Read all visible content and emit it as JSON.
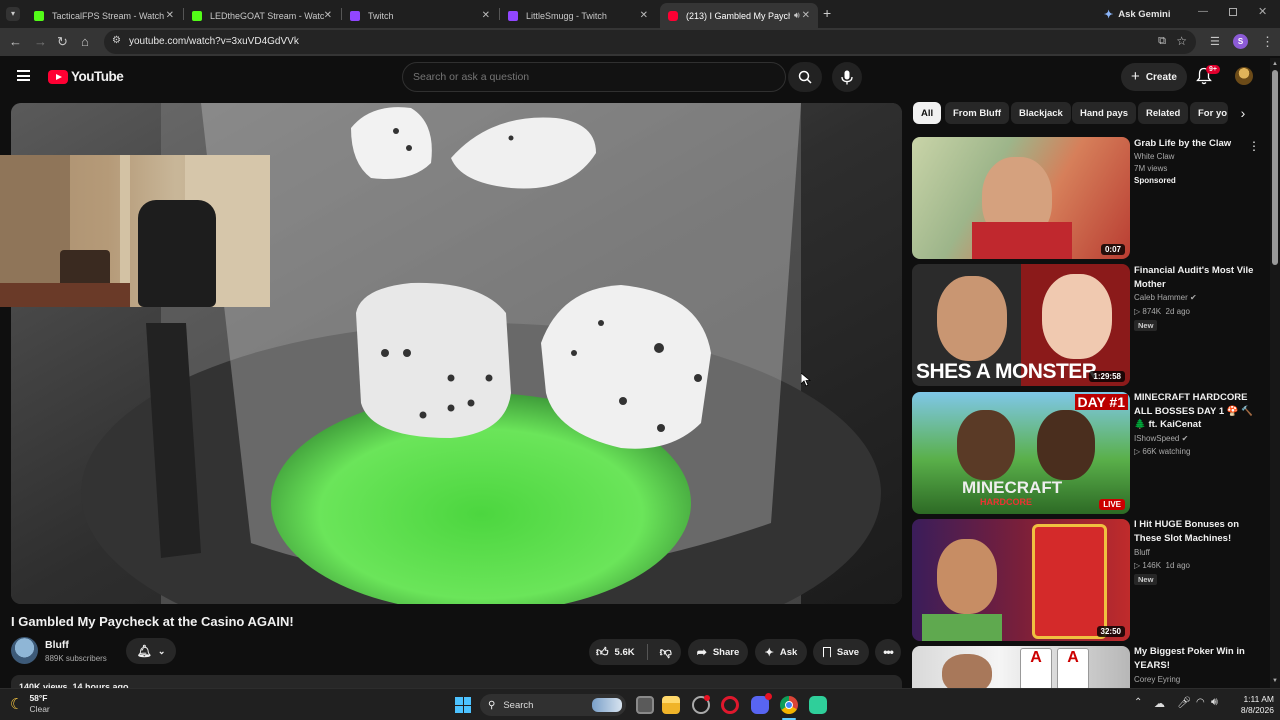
{
  "browser": {
    "tabs": [
      {
        "label": "TacticalFPS Stream - Watch Live",
        "favicon_color": "#53fc18"
      },
      {
        "label": "LEDtheGOAT Stream - Watch Live",
        "favicon_color": "#53fc18"
      },
      {
        "label": "Twitch",
        "favicon_color": "#9146ff"
      },
      {
        "label": "LittleSmugg - Twitch",
        "favicon_color": "#9146ff"
      },
      {
        "label": "(213) I Gambled My Payche",
        "favicon_color": "#ff0033"
      }
    ],
    "new_tab": "+",
    "ask_gemini": "Ask Gemini",
    "url": "youtube.com/watch?v=3xuVD4GdVVk",
    "profile_initial": "S"
  },
  "youtube": {
    "logo_text": "YouTube",
    "search_placeholder": "Search or ask a question",
    "create_label": "Create",
    "notification_count": "9+",
    "video": {
      "title": "I Gambled My Paycheck at the Casino AGAIN!",
      "channel": "Bluff",
      "subscribers": "889K subscribers",
      "likes": "5.6K",
      "share_label": "Share",
      "ask_label": "Ask",
      "save_label": "Save",
      "views_line": "140K views  14 hours ago"
    },
    "chips": [
      "All",
      "From Bluff",
      "Blackjack",
      "Hand pays",
      "Related",
      "For yo"
    ],
    "recommendations": [
      {
        "title": "Grab Life by the Claw",
        "channel": "White Claw",
        "meta": "7M views",
        "badge": "Sponsored",
        "duration": "0:07"
      },
      {
        "title": "Financial Audit's Most Vile Mother",
        "channel": "Caleb Hammer",
        "meta": "874K  2d ago",
        "badge": "New",
        "duration": "1:29:58",
        "thumb_text": "SHES A MONSTER"
      },
      {
        "title": "MINECRAFT HARDCORE ALL BOSSES DAY 1 🍄 🔨 🌲 ft. KaiCenat",
        "channel": "IShowSpeed",
        "meta": "66K watching",
        "badge": "",
        "duration": "LIVE",
        "thumb_text": "MINECRAFT",
        "thumb_text2": "DAY #1",
        "thumb_text3": "HARDCORE"
      },
      {
        "title": "I Hit HUGE Bonuses on These Slot Machines!",
        "channel": "Bluff",
        "meta": "146K  1d ago",
        "badge": "New",
        "duration": "32:50"
      },
      {
        "title": "My Biggest Poker Win in YEARS!",
        "channel": "Corey Eyring",
        "meta": "",
        "badge": "",
        "duration": ""
      }
    ]
  },
  "taskbar": {
    "weather_temp": "58°F",
    "weather_desc": "Clear",
    "search_label": "Search",
    "time": "1:11 AM",
    "date": "8/8/2026"
  }
}
